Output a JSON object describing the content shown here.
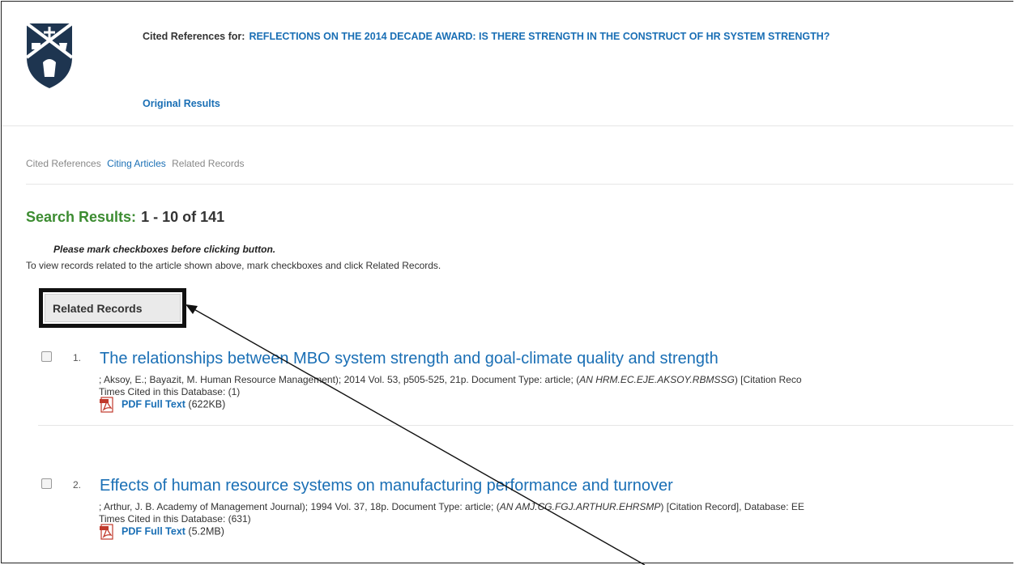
{
  "header": {
    "cited_label": "Cited References for:",
    "article_title": "REFLECTIONS ON THE 2014 DECADE AWARD: IS THERE STRENGTH IN THE CONSTRUCT OF HR SYSTEM STRENGTH?",
    "original_results": "Original Results"
  },
  "subnav": {
    "cited": "Cited References",
    "citing": "Citing Articles",
    "related": "Related Records"
  },
  "results": {
    "label": "Search Results:",
    "range": "1 - 10 of 141",
    "note": "Please mark checkboxes before clicking button.",
    "instruction": "To view records related to the article shown above, mark checkboxes and click Related Records.",
    "button": "Related Records"
  },
  "items": [
    {
      "num": "1.",
      "title": "The relationships between MBO system strength and goal-climate quality and strength",
      "meta_prefix": "; Aksoy, E.; Bayazit, M. Human Resource Management); 2014 Vol. 53, p505-525, 21p. Document Type: article; (",
      "meta_an": "AN HRM.EC.EJE.AKSOY.RBMSSG",
      "meta_suffix": ") [Citation Reco",
      "cited": "Times Cited in this Database: (1)",
      "pdf_label": "PDF Full Text",
      "pdf_size": "(622KB)"
    },
    {
      "num": "2.",
      "title": "Effects of human resource systems on manufacturing performance and turnover",
      "meta_prefix": "; Arthur, J. B. Academy of Management Journal); 1994 Vol. 37, 18p. Document Type: article; (",
      "meta_an": "AN AMJ.CG.FGJ.ARTHUR.EHRSMP",
      "meta_suffix": ") [Citation Record], Database: EE",
      "cited": "Times Cited in this Database: (631)",
      "pdf_label": "PDF Full Text",
      "pdf_size": "(5.2MB)"
    }
  ],
  "colors": {
    "link": "#1a6fb5",
    "heading_green": "#3c8c31",
    "shield": "#1e3550"
  }
}
